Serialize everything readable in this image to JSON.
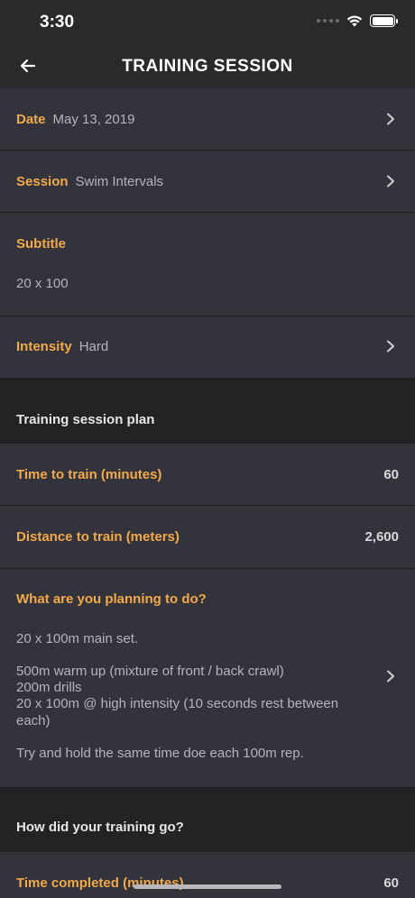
{
  "status_bar": {
    "time": "3:30"
  },
  "nav": {
    "title": "TRAINING SESSION",
    "back_icon": "arrow-left-icon"
  },
  "date_row": {
    "label": "Date",
    "value": "May 13, 2019"
  },
  "session_row": {
    "label": "Session",
    "value": "Swim Intervals"
  },
  "subtitle_row": {
    "label": "Subtitle",
    "value": "20 x 100"
  },
  "intensity_row": {
    "label": "Intensity",
    "value": "Hard"
  },
  "plan_section": {
    "title": "Training session plan"
  },
  "time_row": {
    "label": "Time to train (minutes)",
    "value": "60"
  },
  "distance_row": {
    "label": "Distance to train (meters)",
    "value": "2,600"
  },
  "planning_row": {
    "label": "What are you planning to do?",
    "lines": [
      "20 x 100m main set.",
      "500m warm up (mixture of front / back crawl)",
      "200m drills",
      "20 x 100m @ high intensity (10 seconds rest between",
      "each)",
      "Try and hold the same time doe each 100m rep."
    ]
  },
  "outcome_section": {
    "title": "How did your training go?"
  },
  "time_completed_row": {
    "label": "Time completed (minutes)",
    "value": "60"
  },
  "colors": {
    "accent": "#f2a94a",
    "row_bg": "#33333b",
    "page_bg": "#232326"
  }
}
